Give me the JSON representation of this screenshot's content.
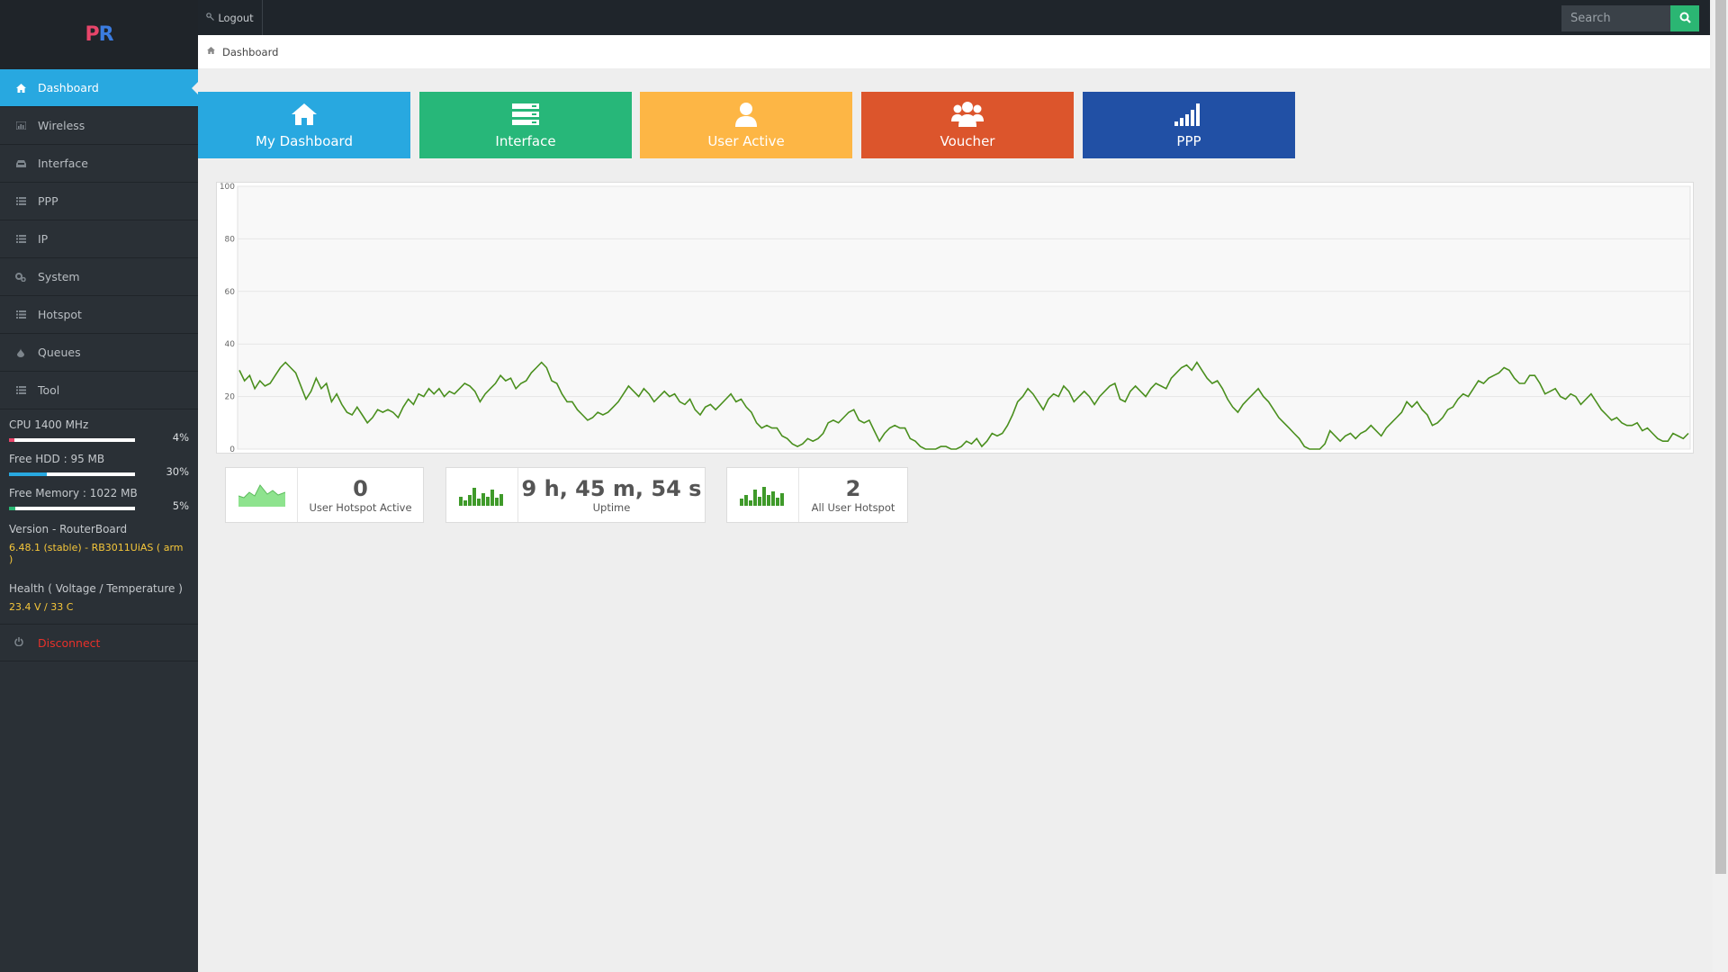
{
  "app": {
    "logo_text": "PR"
  },
  "sidebar": {
    "items": [
      {
        "label": "Dashboard",
        "icon": "home-icon"
      },
      {
        "label": "Wireless",
        "icon": "chart-icon"
      },
      {
        "label": "Interface",
        "icon": "inbox-icon"
      },
      {
        "label": "PPP",
        "icon": "list-icon"
      },
      {
        "label": "IP",
        "icon": "list-icon"
      },
      {
        "label": "System",
        "icon": "gears-icon"
      },
      {
        "label": "Hotspot",
        "icon": "list-icon"
      },
      {
        "label": "Queues",
        "icon": "drop-icon"
      },
      {
        "label": "Tool",
        "icon": "list-icon"
      }
    ],
    "stats": [
      {
        "label": "CPU 1400 MHz",
        "percent_text": "4%",
        "percent": 4,
        "color": "#e8456a"
      },
      {
        "label": "Free HDD : 95 MB",
        "percent_text": "30%",
        "percent": 30,
        "color": "#28a8e0"
      },
      {
        "label": "Free Memory : 1022 MB",
        "percent_text": "5%",
        "percent": 5,
        "color": "#2bb673"
      }
    ],
    "version": {
      "title": "Version - RouterBoard",
      "value": "6.48.1 (stable) - RB3011UiAS ( arm )"
    },
    "health": {
      "title": "Health ( Voltage / Temperature )",
      "value": "23.4 V / 33 C"
    },
    "disconnect_label": "Disconnect"
  },
  "topbar": {
    "logout_label": "Logout",
    "search_placeholder": "Search"
  },
  "breadcrumb": {
    "label": "Dashboard"
  },
  "tiles": [
    {
      "label": "My Dashboard",
      "color": "#28a8e0",
      "icon": "home-icon"
    },
    {
      "label": "Interface",
      "color": "#27b779",
      "icon": "server-icon"
    },
    {
      "label": "User Active",
      "color": "#fdb645",
      "icon": "user-icon"
    },
    {
      "label": "Voucher",
      "color": "#dc552c",
      "icon": "users-icon"
    },
    {
      "label": "PPP",
      "color": "#2150a5",
      "icon": "signal-icon"
    }
  ],
  "chart_data": {
    "type": "line",
    "ylim": [
      0,
      100
    ],
    "yticks": [
      0,
      20,
      40,
      60,
      80,
      100
    ],
    "grid": true,
    "color": "#4a8f1e",
    "values": [
      30,
      26,
      28,
      23,
      26,
      24,
      25,
      28,
      31,
      33,
      31,
      29,
      24,
      19,
      22,
      27,
      23,
      25,
      18,
      21,
      17,
      14,
      13,
      16,
      13,
      10,
      12,
      15,
      14,
      15,
      14,
      12,
      16,
      19,
      17,
      21,
      20,
      23,
      21,
      23,
      20,
      22,
      21,
      23,
      25,
      24,
      22,
      18,
      21,
      23,
      25,
      28,
      26,
      27,
      23,
      25,
      26,
      29,
      31,
      33,
      31,
      26,
      25,
      21,
      18,
      18,
      15,
      13,
      11,
      12,
      14,
      13,
      14,
      16,
      18,
      21,
      24,
      22,
      20,
      23,
      21,
      18,
      20,
      22,
      20,
      21,
      18,
      17,
      19,
      15,
      13,
      16,
      17,
      15,
      17,
      19,
      21,
      18,
      19,
      16,
      14,
      10,
      8,
      9,
      8,
      8,
      5,
      4,
      2,
      1,
      2,
      4,
      3,
      4,
      6,
      10,
      11,
      10,
      12,
      14,
      15,
      11,
      10,
      11,
      7,
      3,
      6,
      8,
      9,
      8,
      8,
      4,
      3,
      1,
      0,
      0,
      0,
      1,
      1,
      0,
      0,
      1,
      3,
      2,
      4,
      1,
      3,
      6,
      5,
      6,
      9,
      13,
      18,
      20,
      23,
      21,
      18,
      15,
      19,
      21,
      20,
      24,
      22,
      18,
      20,
      22,
      20,
      17,
      20,
      22,
      24,
      25,
      19,
      18,
      22,
      24,
      22,
      20,
      23,
      25,
      24,
      23,
      27,
      29,
      31,
      32,
      30,
      33,
      30,
      27,
      25,
      26,
      23,
      19,
      16,
      14,
      17,
      19,
      21,
      23,
      20,
      18,
      15,
      12,
      10,
      8,
      6,
      4,
      1,
      0,
      0,
      0,
      2,
      7,
      5,
      3,
      5,
      6,
      4,
      6,
      7,
      9,
      7,
      5,
      8,
      10,
      12,
      14,
      18,
      16,
      18,
      15,
      13,
      9,
      10,
      12,
      15,
      16,
      19,
      21,
      20,
      23,
      26,
      25,
      27,
      28,
      29,
      31,
      30,
      27,
      25,
      25,
      28,
      28,
      25,
      21,
      22,
      23,
      20,
      19,
      21,
      20,
      17,
      19,
      21,
      18,
      15,
      13,
      11,
      12,
      10,
      9,
      9,
      10,
      7,
      8,
      6,
      4,
      3,
      3,
      6,
      5,
      4,
      6
    ]
  },
  "cards": [
    {
      "value": "0",
      "label": "User Hotspot Active",
      "spark": "area-sparkline-icon"
    },
    {
      "value": "9 h, 45 m, 54 s",
      "label": "Uptime",
      "spark": "bar-sparkline-icon"
    },
    {
      "value": "2",
      "label": "All User Hotspot",
      "spark": "bar-sparkline-icon"
    }
  ]
}
